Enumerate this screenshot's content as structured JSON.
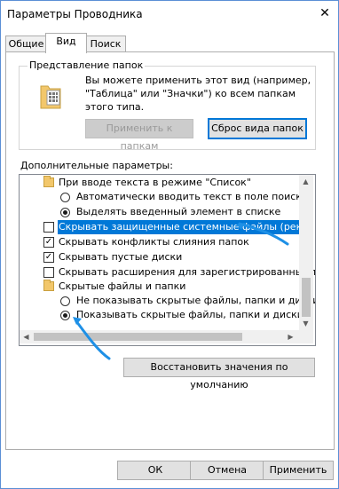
{
  "window": {
    "title": "Параметры Проводника",
    "close_glyph": "✕"
  },
  "tabs": [
    {
      "label": "Общие"
    },
    {
      "label": "Вид"
    },
    {
      "label": "Поиск"
    }
  ],
  "folder_view": {
    "group_title": "Представление папок",
    "description_line1": "Вы можете применить этот вид (например,",
    "description_line2": "\"Таблица\" или \"Значки\") ко всем папкам",
    "description_line3": "этого типа.",
    "apply_button": "Применить к папкам",
    "reset_button": "Сброс вида папок"
  },
  "advanced": {
    "group_title": "Дополнительные параметры:",
    "items": [
      {
        "kind": "folder",
        "label": "При вводе текста в режиме \"Список\""
      },
      {
        "kind": "radio",
        "checked": false,
        "label": "Автоматически вводить текст в поле поиска"
      },
      {
        "kind": "radio",
        "checked": true,
        "label": "Выделять введенный элемент в списке"
      },
      {
        "kind": "checkbox",
        "checked": false,
        "selected": true,
        "label": "Скрывать защищенные системные файлы (рекомен"
      },
      {
        "kind": "checkbox",
        "checked": true,
        "label": "Скрывать конфликты слияния папок"
      },
      {
        "kind": "checkbox",
        "checked": true,
        "label": "Скрывать пустые диски"
      },
      {
        "kind": "checkbox",
        "checked": false,
        "label": "Скрывать расширения для зарегистрированных типо"
      },
      {
        "kind": "folder",
        "label": "Скрытые файлы и папки"
      },
      {
        "kind": "radio",
        "checked": false,
        "label": "Не показывать скрытые файлы, папки и диски"
      },
      {
        "kind": "radio",
        "checked": true,
        "label": "Показывать скрытые файлы, папки и диски"
      }
    ],
    "check_glyph": "✓",
    "restore_button": "Восстановить значения по умолчанию"
  },
  "footer": {
    "ok": "ОК",
    "cancel": "Отмена",
    "apply": "Применить"
  },
  "colors": {
    "selection": "#0078d7",
    "annotation_arrow": "#1e90e6"
  }
}
